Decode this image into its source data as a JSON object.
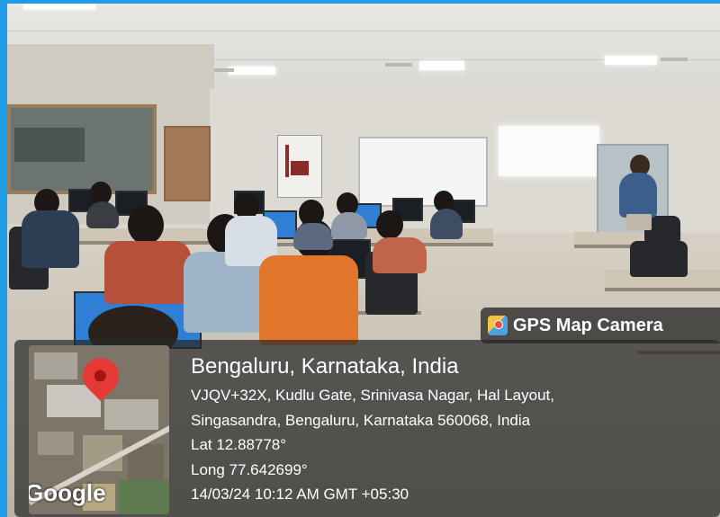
{
  "overlay": {
    "brand": "GPS Map Camera",
    "brand_icon": "gps-map-camera-icon",
    "city": "Bengaluru, Karnataka, India",
    "address_line_1": "VJQV+32X, Kudlu Gate, Srinivasa Nagar, Hal Layout,",
    "address_line_2": "Singasandra, Bengaluru, Karnataka 560068, India",
    "latitude": "Lat 12.88778°",
    "longitude": "Long 77.642699°",
    "timestamp": "14/03/24 10:12 AM GMT +05:30",
    "map_logo": "Google"
  },
  "colors": {
    "frame_border": "#1e9de6",
    "pin": "#e53935",
    "overlay_bg": "rgba(40,40,40,0.72)"
  }
}
